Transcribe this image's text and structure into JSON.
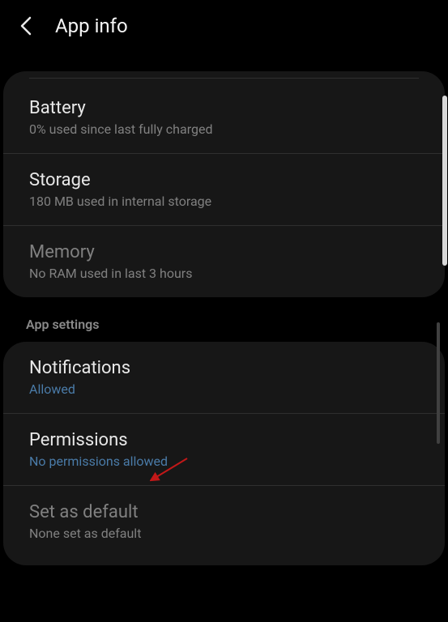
{
  "header": {
    "title": "App info"
  },
  "usage": {
    "battery": {
      "title": "Battery",
      "subtitle": "0% used since last fully charged"
    },
    "storage": {
      "title": "Storage",
      "subtitle": "180 MB used in internal storage"
    },
    "memory": {
      "title": "Memory",
      "subtitle": "No RAM used in last 3 hours"
    }
  },
  "section_header": "App settings",
  "app_settings": {
    "notifications": {
      "title": "Notifications",
      "subtitle": "Allowed"
    },
    "permissions": {
      "title": "Permissions",
      "subtitle": "No permissions allowed"
    },
    "set_default": {
      "title": "Set as default",
      "subtitle": "None set as default"
    }
  }
}
